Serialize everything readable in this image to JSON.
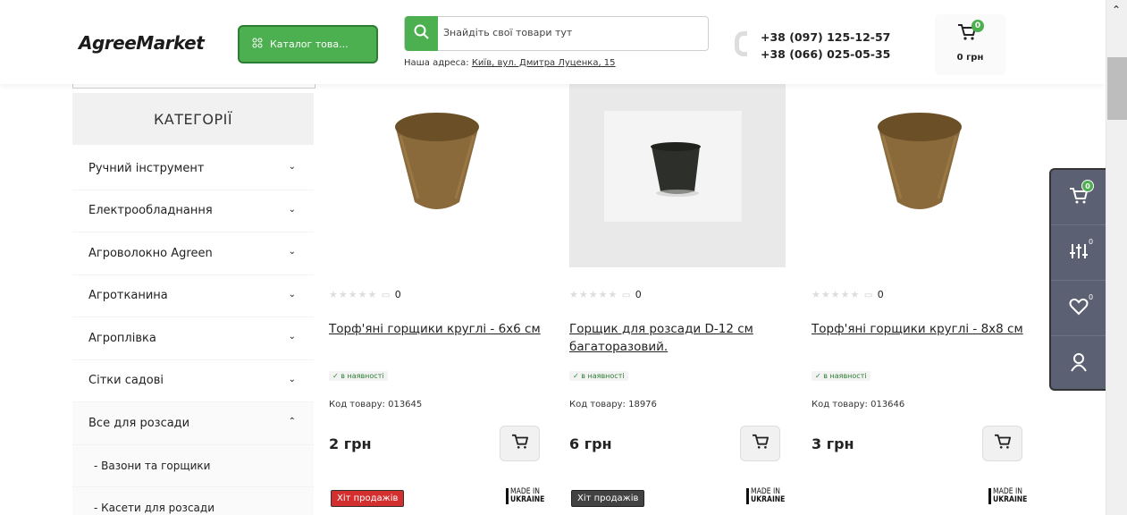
{
  "header": {
    "logo": "AgreeMarket",
    "catalog_label": "Каталог това...",
    "search_placeholder": "Знайдіть свої товари тут",
    "address_prefix": "Наша адреса: ",
    "address_link": "Київ, вул. Дмитра Луценка, 15",
    "phone1": "+38 (097) 125-12-57",
    "phone2": "+38 (066) 025-05-35",
    "cart_count": "0",
    "cart_total": "0 грн"
  },
  "sidebar": {
    "title": "КАТЕГОРІЇ",
    "items": [
      {
        "label": "Ручний інструмент",
        "chevron": "⌄"
      },
      {
        "label": "Електрообладнання",
        "chevron": "⌄"
      },
      {
        "label": "Агроволокно Agreen",
        "chevron": "⌄"
      },
      {
        "label": "Агротканина",
        "chevron": "⌄"
      },
      {
        "label": "Агроплівка",
        "chevron": "⌄"
      },
      {
        "label": "Сітки садові",
        "chevron": "⌄"
      },
      {
        "label": "Все для розсади",
        "chevron": "⌃"
      }
    ],
    "subitems": [
      {
        "label": "- Вазони та горщики"
      },
      {
        "label": "- Касети для розсади"
      }
    ]
  },
  "products": [
    {
      "rating_stars": "★★★★★",
      "reviews": "0",
      "title": "Торф'яні горщики круглі - 6х6 см",
      "stock": "✓ в наявності",
      "code": "Код товару: 013645",
      "price": "2 грн",
      "badge": "Хіт продажів",
      "badge_color": "#d32f2f",
      "made_line1": "MADE IN",
      "made_line2": "UKRAINE"
    },
    {
      "rating_stars": "★★★★★",
      "reviews": "0",
      "title": "Горщик для розсади D-12 см багаторазовий.",
      "stock": "✓ в наявності",
      "code": "Код товару: 18976",
      "price": "6 грн",
      "badge": "Хіт продажів",
      "badge_color": "#424242",
      "made_line1": "MADE IN",
      "made_line2": "UKRAINE"
    },
    {
      "rating_stars": "★★★★★",
      "reviews": "0",
      "title": "Торф'яні горщики круглі - 8х8 см",
      "stock": "✓ в наявності",
      "code": "Код товару: 013646",
      "price": "3 грн",
      "made_line1": "MADE IN",
      "made_line2": "UKRAINE"
    }
  ],
  "float_panel": {
    "cart_count": "0",
    "compare_count": "0",
    "wishlist_count": "0"
  },
  "colors": {
    "accent": "#4caf50",
    "panel": "#5b6172"
  }
}
